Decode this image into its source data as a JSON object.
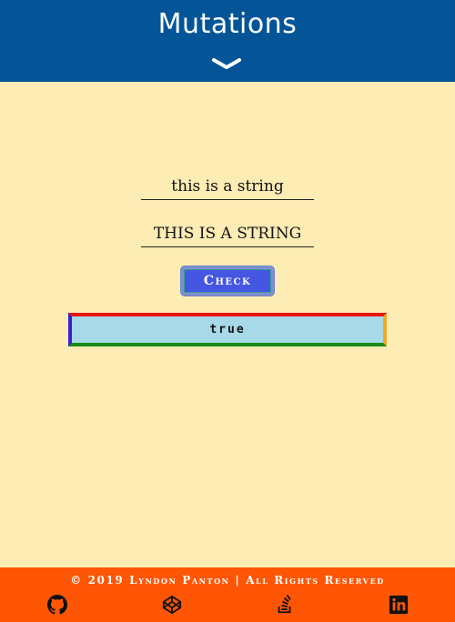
{
  "header": {
    "title": "Mutations",
    "toggle_icon": "chevron-down-icon"
  },
  "main": {
    "input_1": {
      "value": "this is a string"
    },
    "input_2": {
      "value": "THIS IS A STRING"
    },
    "check_label": "Check",
    "result": "TRUE",
    "colors": {
      "button": "#4556e3",
      "result_bg": "#a7d9e9",
      "border_top": "#e8150f",
      "border_right": "#f0a728",
      "border_bottom": "#1a8a1a",
      "border_left": "#3a22c9"
    }
  },
  "footer": {
    "copyright": "© 2019 Lyndon Panton | All Rights Reserved",
    "social": [
      {
        "icon": "github-icon"
      },
      {
        "icon": "codepen-icon"
      },
      {
        "icon": "stack-overflow-icon"
      },
      {
        "icon": "linkedin-icon"
      }
    ]
  },
  "colors": {
    "header_bg": "#035598",
    "page_bg": "#fdecb4",
    "footer_bg": "#fe5605"
  }
}
